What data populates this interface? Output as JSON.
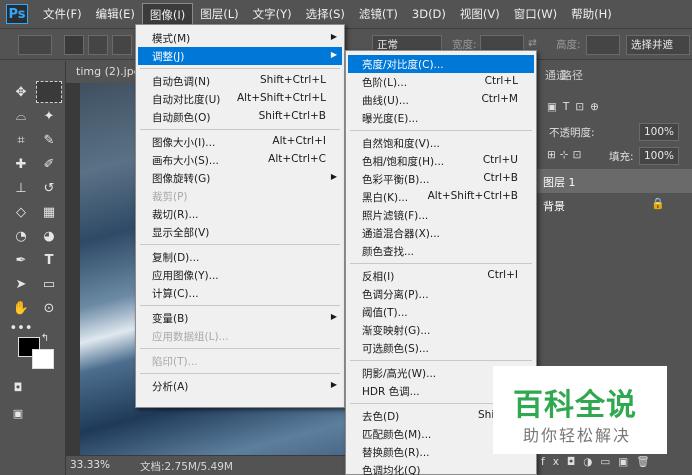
{
  "app": {
    "logo": "Ps"
  },
  "menubar": [
    "文件(F)",
    "编辑(E)",
    "图像(I)",
    "图层(L)",
    "文字(Y)",
    "选择(S)",
    "滤镜(T)",
    "3D(D)",
    "视图(V)",
    "窗口(W)",
    "帮助(H)"
  ],
  "options": {
    "style_value": "正常",
    "width_label": "宽度:",
    "height_label": "高度:",
    "select_button": "选择并遮"
  },
  "document": {
    "tab": "timg (2).jpg",
    "zoom": "33.33%",
    "info": "文档:2.75M/5.49M"
  },
  "panels": {
    "tabs": [
      "通道",
      "路径"
    ],
    "opacity_label": "不透明度:",
    "opacity_value": "100%",
    "fill_label": "填充:",
    "fill_value": "100%",
    "layers": [
      "图层 1",
      "背景"
    ]
  },
  "image_menu": [
    {
      "label": "模式(M)",
      "submenu": true
    },
    {
      "label": "调整(J)",
      "submenu": true,
      "highlight": true
    },
    {
      "sep": true
    },
    {
      "label": "自动色调(N)",
      "shortcut": "Shift+Ctrl+L"
    },
    {
      "label": "自动对比度(U)",
      "shortcut": "Alt+Shift+Ctrl+L"
    },
    {
      "label": "自动颜色(O)",
      "shortcut": "Shift+Ctrl+B"
    },
    {
      "sep": true
    },
    {
      "label": "图像大小(I)...",
      "shortcut": "Alt+Ctrl+I"
    },
    {
      "label": "画布大小(S)...",
      "shortcut": "Alt+Ctrl+C"
    },
    {
      "label": "图像旋转(G)",
      "submenu": true
    },
    {
      "label": "裁剪(P)",
      "disabled": true
    },
    {
      "label": "裁切(R)..."
    },
    {
      "label": "显示全部(V)"
    },
    {
      "sep": true
    },
    {
      "label": "复制(D)..."
    },
    {
      "label": "应用图像(Y)..."
    },
    {
      "label": "计算(C)..."
    },
    {
      "sep": true
    },
    {
      "label": "变量(B)",
      "submenu": true
    },
    {
      "label": "应用数据组(L)...",
      "disabled": true
    },
    {
      "sep": true
    },
    {
      "label": "陷印(T)...",
      "disabled": true
    },
    {
      "sep": true
    },
    {
      "label": "分析(A)",
      "submenu": true
    }
  ],
  "adjust_menu": [
    {
      "label": "亮度/对比度(C)...",
      "highlight": true
    },
    {
      "label": "色阶(L)...",
      "shortcut": "Ctrl+L"
    },
    {
      "label": "曲线(U)...",
      "shortcut": "Ctrl+M"
    },
    {
      "label": "曝光度(E)..."
    },
    {
      "sep": true
    },
    {
      "label": "自然饱和度(V)..."
    },
    {
      "label": "色相/饱和度(H)...",
      "shortcut": "Ctrl+U"
    },
    {
      "label": "色彩平衡(B)...",
      "shortcut": "Ctrl+B"
    },
    {
      "label": "黑白(K)...",
      "shortcut": "Alt+Shift+Ctrl+B"
    },
    {
      "label": "照片滤镜(F)..."
    },
    {
      "label": "通道混合器(X)..."
    },
    {
      "label": "颜色查找..."
    },
    {
      "sep": true
    },
    {
      "label": "反相(I)",
      "shortcut": "Ctrl+I"
    },
    {
      "label": "色调分离(P)..."
    },
    {
      "label": "阈值(T)..."
    },
    {
      "label": "渐变映射(G)..."
    },
    {
      "label": "可选颜色(S)..."
    },
    {
      "sep": true
    },
    {
      "label": "阴影/高光(W)..."
    },
    {
      "label": "HDR 色调..."
    },
    {
      "sep": true
    },
    {
      "label": "去色(D)",
      "shortcut": "Shift+C"
    },
    {
      "label": "匹配颜色(M)..."
    },
    {
      "label": "替换颜色(R)..."
    },
    {
      "label": "色调均化(Q)"
    }
  ],
  "watermark": {
    "title": "百科全说",
    "subtitle": "助你轻松解决"
  }
}
